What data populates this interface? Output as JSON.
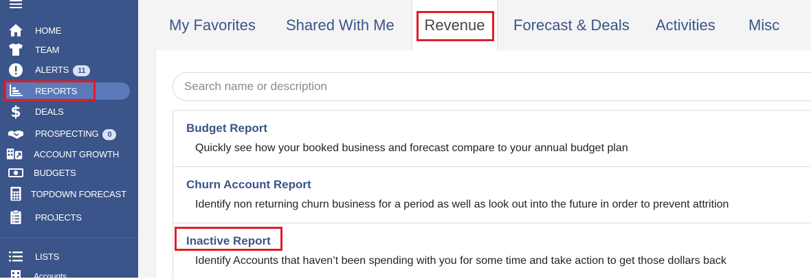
{
  "sidebar": {
    "items": [
      {
        "label": "HOME",
        "icon": "home-icon"
      },
      {
        "label": "TEAM",
        "icon": "shirt-icon"
      },
      {
        "label": "ALERTS",
        "icon": "alert-icon",
        "badge": "11"
      },
      {
        "label": "REPORTS",
        "icon": "bar-chart-icon"
      },
      {
        "label": "DEALS",
        "icon": "dollar-icon"
      },
      {
        "label": "PROSPECTING",
        "icon": "handshake-icon",
        "badge": "0"
      },
      {
        "label": "ACCOUNT GROWTH",
        "icon": "building-arrow-icon"
      },
      {
        "label": "BUDGETS",
        "icon": "money-icon"
      },
      {
        "label": "TOPDOWN FORECAST",
        "icon": "calculator-icon"
      },
      {
        "label": "PROJECTS",
        "icon": "clipboard-icon"
      },
      {
        "label": "LISTS",
        "icon": "list-icon"
      },
      {
        "label": "Accounts",
        "icon": "grid-icon"
      }
    ]
  },
  "tabs": [
    {
      "label": "My Favorites"
    },
    {
      "label": "Shared With Me"
    },
    {
      "label": "Revenue",
      "active": true
    },
    {
      "label": "Forecast & Deals"
    },
    {
      "label": "Activities"
    },
    {
      "label": "Misc"
    }
  ],
  "search": {
    "placeholder": "Search name or description",
    "value": ""
  },
  "reports": [
    {
      "title": "Budget Report",
      "description": "Quickly see how your booked business and forecast compare to your annual budget plan"
    },
    {
      "title": "Churn Account Report",
      "description": "Identify non returning churn business for a period as well as look out into the future in order to prevent attrition"
    },
    {
      "title": "Inactive Report",
      "description": "Identify Accounts that haven’t been spending with you for some time and take action to get those dollars back"
    }
  ],
  "colors": {
    "sidebar": "#3b5489",
    "accent": "#3b5489",
    "highlight": "#e21b25"
  }
}
